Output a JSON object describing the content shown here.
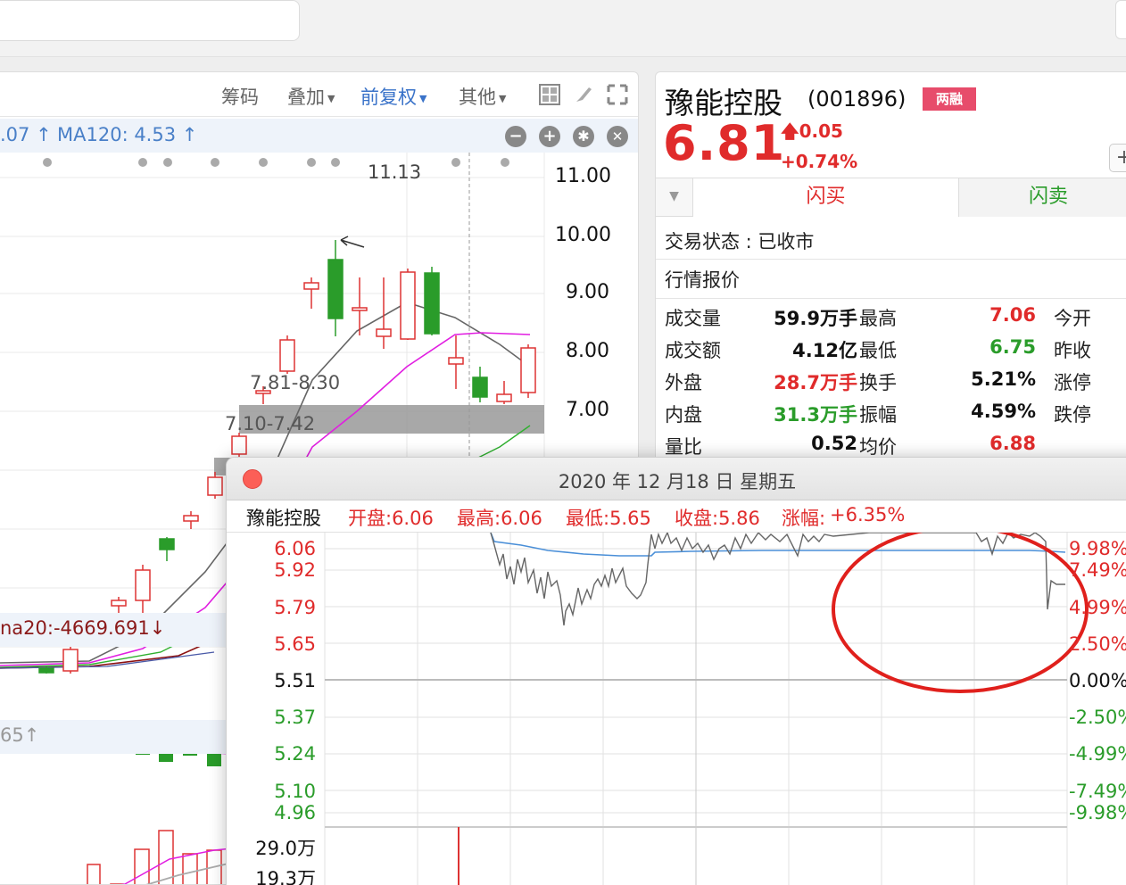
{
  "kline_panel": {
    "toolbar": {
      "chips": "筹码",
      "overlay": "叠加",
      "fq": "前复权",
      "other": "其他"
    },
    "ma_bar": {
      "prev_ma_partial": ".07 ↑",
      "ma120": "MA120: 4.53 ↑"
    },
    "y_axis": [
      "11.00",
      "10.00",
      "9.00",
      "8.00",
      "7.00"
    ],
    "annotations": {
      "high": "11.13",
      "zone1": "7.81-8.30",
      "zone2": "7.10-7.42"
    },
    "sub1_label": "na20:-4669.691↓",
    "sub2_label": "65↑"
  },
  "quote": {
    "name": "豫能控股",
    "code": "(001896)",
    "badge": "两融",
    "price": "6.81",
    "change": "0.05",
    "change_pct": "+0.74%",
    "plus": "+",
    "flash_buy": "闪买",
    "flash_sell": "闪卖",
    "trade_status": "交易状态 : 已收市",
    "section": "行情报价",
    "rows": [
      {
        "l1": "成交量",
        "v1": "59.9万手",
        "l2": "最高",
        "v2": "7.06",
        "l3": "今开"
      },
      {
        "l1": "成交额",
        "v1": "4.12亿",
        "l2": "最低",
        "v2": "6.75",
        "l3": "昨收"
      },
      {
        "l1": "外盘",
        "v1": "28.7万手",
        "l2": "换手",
        "v2": "5.21%",
        "l3": "涨停"
      },
      {
        "l1": "内盘",
        "v1": "31.3万手",
        "l2": "振幅",
        "v2": "4.59%",
        "l3": "跌停"
      },
      {
        "l1": "量比",
        "v1": "0.52",
        "l2": "均价",
        "v2": "6.88",
        "l3": ""
      }
    ]
  },
  "popup": {
    "title": "2020 年 12 月18 日 星期五",
    "stock": "豫能控股",
    "open": "开盘:6.06",
    "high": "最高:6.06",
    "low": "最低:5.65",
    "close": "收盘:5.86",
    "change_label": "涨幅:",
    "change_value": "+6.35%",
    "left_axis": [
      "6.06",
      "5.92",
      "5.79",
      "5.65",
      "5.51",
      "5.37",
      "5.24",
      "5.10",
      "4.96"
    ],
    "right_axis": [
      "9.98%",
      "7.49%",
      "4.99%",
      "2.50%",
      "0.00%",
      "-2.50%",
      "-4.99%",
      "-7.49%",
      "-9.98%"
    ],
    "volume_axis": [
      "29.0万",
      "19.3万"
    ]
  },
  "colors": {
    "up": "#e02b2b",
    "down": "#2a9c2a",
    "accent": "#3a73c9",
    "circle": "#e0201c"
  }
}
